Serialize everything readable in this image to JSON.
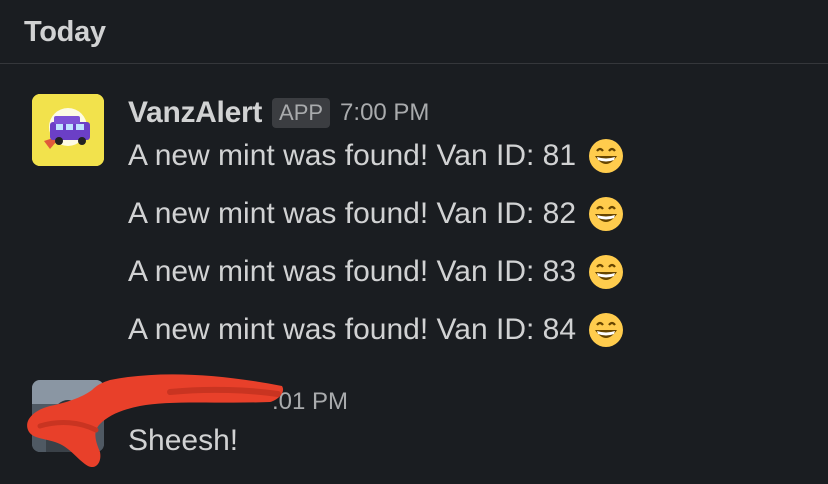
{
  "day_divider": {
    "label": "Today"
  },
  "messages": [
    {
      "sender": "VanzAlert",
      "badge": "APP",
      "time": "7:00 PM",
      "avatar_icon": "purple-van-icon",
      "lines": [
        {
          "text": "A new mint was found! Van ID: 81",
          "emoji": "grinning-face-emoji"
        },
        {
          "text": "A new mint was found! Van ID: 82",
          "emoji": "grinning-face-emoji"
        },
        {
          "text": "A new mint was found! Van ID: 83",
          "emoji": "grinning-face-emoji"
        },
        {
          "text": "A new mint was found! Van ID: 84",
          "emoji": "grinning-face-emoji"
        }
      ]
    },
    {
      "sender": "",
      "time": ":01 PM",
      "avatar_icon": "user-avatar",
      "redacted": true,
      "lines": [
        {
          "text": "Sheesh!"
        }
      ]
    }
  ],
  "colors": {
    "background": "#1a1d21",
    "text": "#d1d2d3",
    "muted": "#a9abad",
    "badge_bg": "#3b3d41",
    "bot_avatar_bg": "#f2e24c",
    "redaction": "#e8402a"
  }
}
